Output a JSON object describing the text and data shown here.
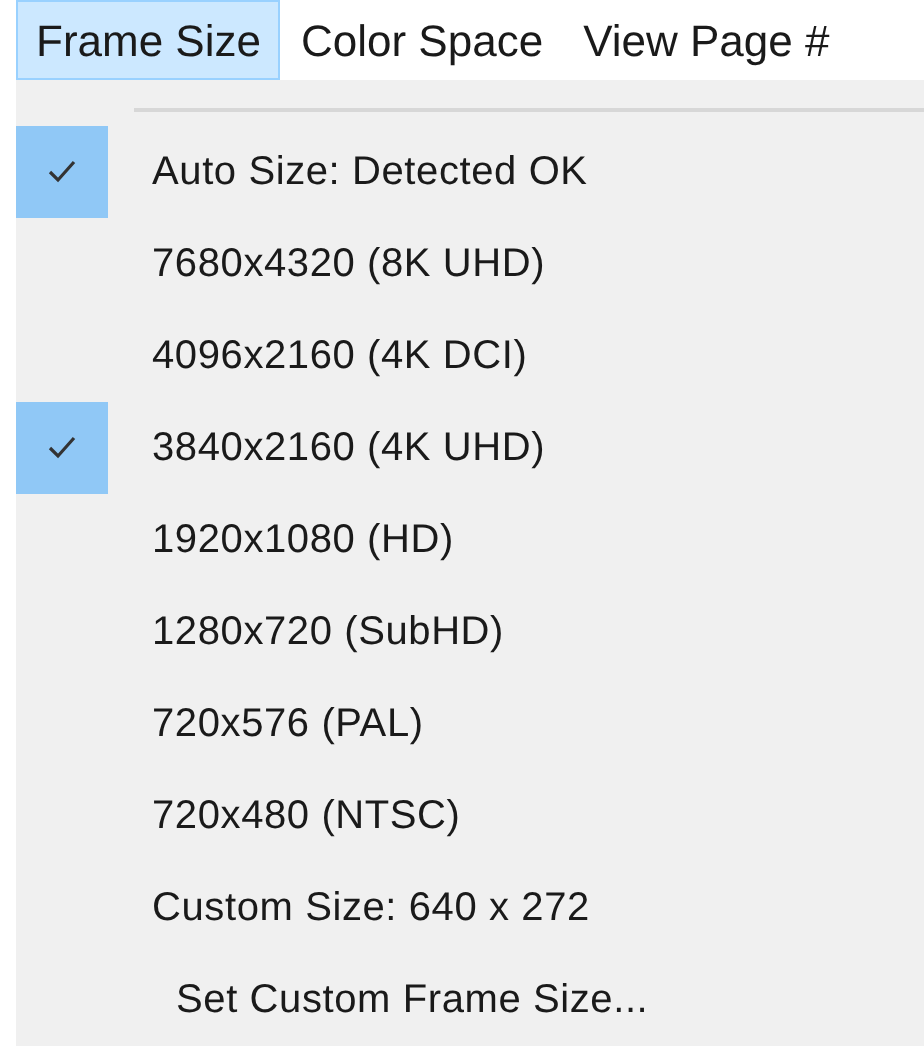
{
  "menubar": [
    {
      "label": "Frame Size",
      "selected": true
    },
    {
      "label": "Color Space",
      "selected": false
    },
    {
      "label": "View Page #",
      "selected": false
    }
  ],
  "menu": {
    "items": [
      {
        "label": "Auto Size: Detected OK",
        "checked": true,
        "kind": "option"
      },
      {
        "label": "7680x4320 (8K UHD)",
        "checked": false,
        "kind": "option"
      },
      {
        "label": "4096x2160 (4K DCI)",
        "checked": false,
        "kind": "option"
      },
      {
        "label": "3840x2160 (4K UHD)",
        "checked": true,
        "kind": "option"
      },
      {
        "label": "1920x1080 (HD)",
        "checked": false,
        "kind": "option"
      },
      {
        "label": "1280x720 (SubHD)",
        "checked": false,
        "kind": "option"
      },
      {
        "label": "720x576 (PAL)",
        "checked": false,
        "kind": "option"
      },
      {
        "label": "720x480 (NTSC)",
        "checked": false,
        "kind": "option"
      },
      {
        "label": "Custom Size: 640 x 272",
        "checked": false,
        "kind": "option"
      },
      {
        "label": "Set Custom Frame Size...",
        "checked": false,
        "kind": "command"
      }
    ]
  }
}
